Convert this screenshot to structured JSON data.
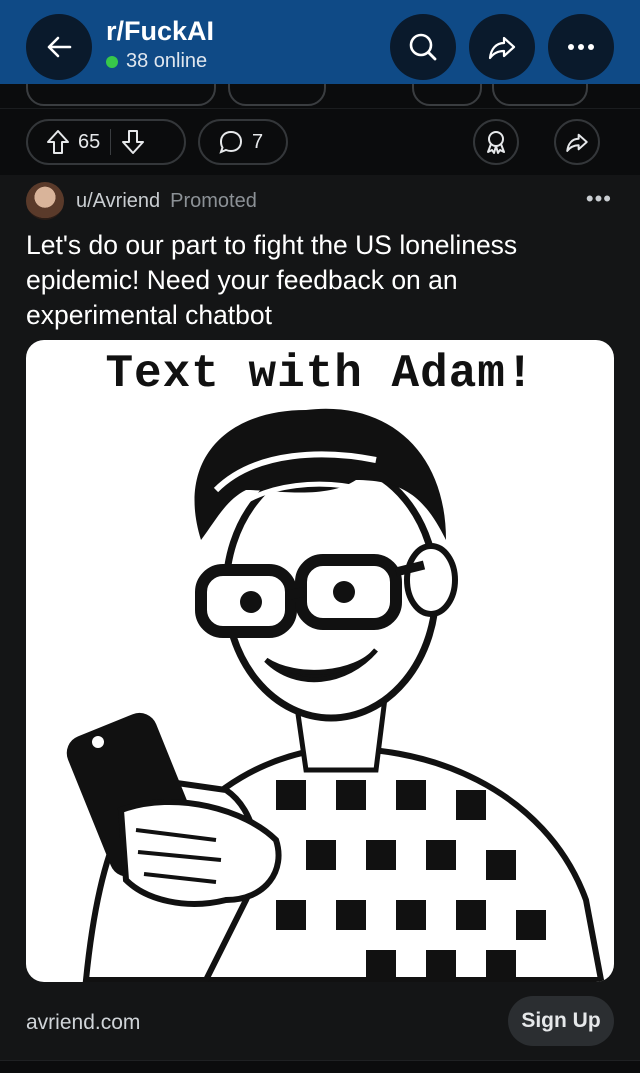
{
  "header": {
    "title": "r/FuckAI",
    "online": "38 online",
    "icons": [
      "back-arrow-icon",
      "search-icon",
      "share-icon",
      "more-icon"
    ],
    "colors": {
      "bar": "#0f4a86",
      "online_dot": "#37c84a"
    }
  },
  "actions": {
    "upvotes": "65",
    "comments": "7",
    "icons": [
      "upvote-icon",
      "downvote-icon",
      "comment-icon",
      "award-icon",
      "share-icon"
    ]
  },
  "post": {
    "username": "u/Avriend",
    "tag": "Promoted",
    "more": "•••",
    "title": "Let's do our part to fight the US loneliness epidemic! Need your feedback on an experimental chatbot",
    "image_caption": "Text with Adam!",
    "domain": "avriend.com",
    "cta": "Sign Up"
  }
}
